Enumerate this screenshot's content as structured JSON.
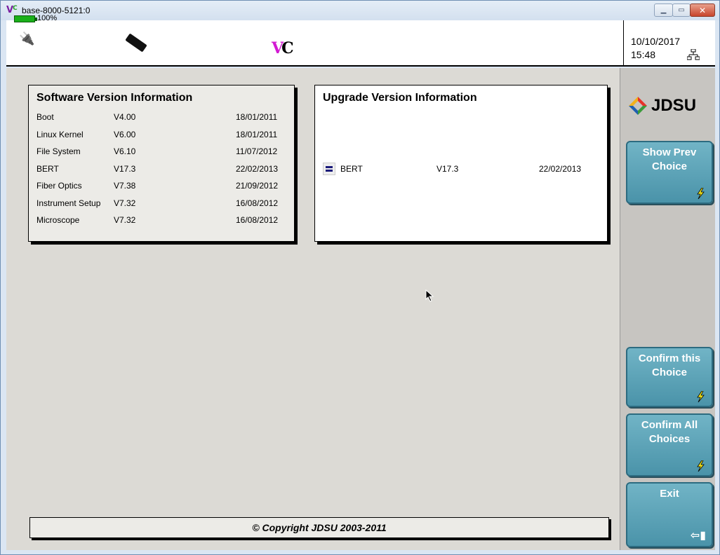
{
  "window": {
    "title": "base-8000-5121:0",
    "app_icon_text": "V",
    "app_icon_sup": "C",
    "buttons": [
      "minimize-icon",
      "maximize-icon",
      "close-icon"
    ]
  },
  "statusbar": {
    "battery_percent": "100%",
    "battery_level": 1.0,
    "icons": [
      "battery-icon",
      "power-plug-icon",
      "usb-stick-icon",
      "vnc-logo",
      "network-icon"
    ],
    "date": "10/10/2017",
    "time": "15:48"
  },
  "software_panel": {
    "title": "Software Version Information",
    "rows": [
      {
        "name": "Boot",
        "version": "V4.00",
        "date": "18/01/2011"
      },
      {
        "name": "Linux Kernel",
        "version": "V6.00",
        "date": "18/01/2011"
      },
      {
        "name": "File System",
        "version": "V6.10",
        "date": "11/07/2012"
      },
      {
        "name": "BERT",
        "version": "V17.3",
        "date": "22/02/2013"
      },
      {
        "name": "Fiber Optics",
        "version": "V7.38",
        "date": "21/09/2012"
      },
      {
        "name": "Instrument Setup",
        "version": "V7.32",
        "date": "16/08/2012"
      },
      {
        "name": "Microscope",
        "version": "V7.32",
        "date": "16/08/2012"
      }
    ]
  },
  "upgrade_panel": {
    "title": "Upgrade Version Information",
    "rows": [
      {
        "name": "BERT",
        "version": "V17.3",
        "date": "22/02/2013"
      }
    ]
  },
  "copyright": "© Copyright JDSU 2003-2011",
  "sidebar": {
    "logo_text": "JDSU",
    "buttons": {
      "show_prev": "Show Prev Choice",
      "confirm": "Confirm this Choice",
      "confirm_all": "Confirm All Choices",
      "exit": "Exit"
    }
  },
  "colors": {
    "side_button": "#5aa3b8",
    "battery": "#1ab01a",
    "bolt": "#f5e61a"
  }
}
